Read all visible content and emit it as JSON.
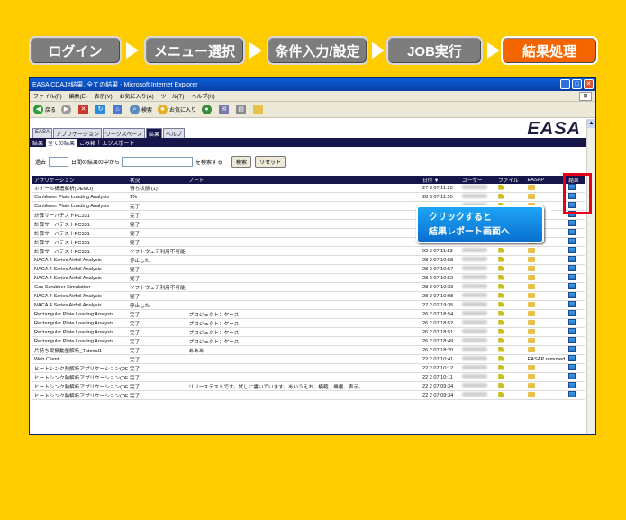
{
  "steps": [
    {
      "label": "ログイン",
      "active": false
    },
    {
      "label": "メニュー選択",
      "active": false
    },
    {
      "label": "条件入力/設定",
      "active": false
    },
    {
      "label": "JOB実行",
      "active": false
    },
    {
      "label": "結果処理",
      "active": true
    }
  ],
  "colors": {
    "background": "#FFCC00",
    "active_step": "#F46500",
    "step": "#7D7D7D",
    "highlight": "#E8001A",
    "callout": "#1CA5F5"
  },
  "browser": {
    "title": "EASA CDAJ#結果, 全ての結果 - Microsoft Internet Explorer",
    "menu": [
      "ファイル(F)",
      "編集(E)",
      "表示(V)",
      "お気に入り(A)",
      "ツール(T)",
      "ヘルプ(H)"
    ],
    "toolbar": {
      "back": "戻る",
      "search": "検索",
      "favorites": "お気に入り"
    }
  },
  "app": {
    "logo": "EASA",
    "tabs": [
      "EASA",
      "アプリケーション",
      "ワークスペース",
      "結果",
      "ヘルプ"
    ],
    "active_tab": "結果",
    "nav": [
      "結果",
      "全ての結果",
      "ごみ箱",
      "エクスポート"
    ],
    "nav_selected": "全ての結果",
    "search": {
      "prefix": "過去",
      "mid": "日間の結果の中から",
      "suffix": "を検索する",
      "search_button": "検索",
      "reset_button": "リセット"
    },
    "columns": [
      "アプリケーション",
      "状況",
      "ノート",
      "日付",
      "ユーザー",
      "ファイル",
      "EASAP",
      "結果"
    ],
    "rows": [
      {
        "app": "ホイール構造解析(DEMO)",
        "status": "待ち状態 (1)",
        "note": "",
        "date": "27 3 07 11:25",
        "easap": "folder"
      },
      {
        "app": "Cantilever Plate Loading Analysis",
        "status": "1%",
        "note": "",
        "date": "28 3 07 11:55",
        "easap": "folder"
      },
      {
        "app": "Cantilever Plate Loading Analysis",
        "status": "完了",
        "note": "",
        "date": "",
        "easap": "folder"
      },
      {
        "app": "計算サーバテストPC331",
        "status": "完了",
        "note": "",
        "date": "",
        "easap": "folder"
      },
      {
        "app": "計算サーバテストPC331",
        "status": "完了",
        "note": "",
        "date": "",
        "easap": "folder"
      },
      {
        "app": "計算サーバテストPC331",
        "status": "完了",
        "note": "",
        "date": "",
        "easap": "folder"
      },
      {
        "app": "計算サーバテストPC331",
        "status": "完了",
        "note": "",
        "date": "02 3 07 11:57",
        "easap": "folder"
      },
      {
        "app": "計算サーバテストPC331",
        "status": "ソフトウェア利用不可能",
        "note": "",
        "date": "02 3 07 11:53",
        "easap": "folder"
      },
      {
        "app": "NACA 4 Series Airfoil Analysis",
        "status": "停止した",
        "note": "",
        "date": "28 2 07 10:58",
        "easap": "folder"
      },
      {
        "app": "NACA 4 Series Airfoil Analysis",
        "status": "完了",
        "note": "",
        "date": "28 2 07 10:57",
        "easap": "folder"
      },
      {
        "app": "NACA 4 Series Airfoil Analysis",
        "status": "完了",
        "note": "",
        "date": "28 2 07 10:52",
        "easap": "folder"
      },
      {
        "app": "Gas Scrubber Simulation",
        "status": "ソフトウェア利用不可能",
        "note": "",
        "date": "28 2 07 10:23",
        "easap": "folder"
      },
      {
        "app": "NACA 4 Series Airfoil Analysis",
        "status": "完了",
        "note": "",
        "date": "28 2 07 10:08",
        "easap": "folder"
      },
      {
        "app": "NACA 4 Series Airfoil Analysis",
        "status": "停止した",
        "note": "",
        "date": "27 2 07 19:35",
        "easap": "folder"
      },
      {
        "app": "Rectangular Plate Loading Analysis",
        "status": "完了",
        "note": "プロジェクト：ケース",
        "date": "26 2 07 18:54",
        "easap": "folder"
      },
      {
        "app": "Rectangular Plate Loading Analysis",
        "status": "完了",
        "note": "プロジェクト：ケース",
        "date": "26 2 07 18:52",
        "easap": "folder"
      },
      {
        "app": "Rectangular Plate Loading Analysis",
        "status": "完了",
        "note": "プロジェクト：ケース",
        "date": "26 2 07 18:51",
        "easap": "folder"
      },
      {
        "app": "Rectangular Plate Loading Analysis",
        "status": "完了",
        "note": "プロジェクト：ケース",
        "date": "26 2 07 18:49",
        "easap": "folder"
      },
      {
        "app": "片持ち梁振動量解析_Tutorial1",
        "status": "完了",
        "note": "あああ",
        "date": "26 2 07 18:20",
        "easap": "folder"
      },
      {
        "app": "Web Client",
        "status": "完了",
        "note": "",
        "date": "22 2 07 10:41",
        "easap": "EASAP removed"
      },
      {
        "app": "ヒートシンク熱解析アプリケーション(DEMO)",
        "status": "完了",
        "note": "",
        "date": "22 2 07 10:12",
        "easap": "folder"
      },
      {
        "app": "ヒートシンク熱解析アプリケーション(DEMO)",
        "status": "完了",
        "note": "",
        "date": "22 2 07 10:11",
        "easap": "folder"
      },
      {
        "app": "ヒートシンク熱解析アプリケーション(DEMO)",
        "status": "完了",
        "note": "リリーステストです。試しに書いています。あいうえお、模範、乗権、表示。",
        "date": "22 2 07 09:34",
        "easap": "folder"
      },
      {
        "app": "ヒートシンク熱解析アプリケーション(DEMO)",
        "status": "完了",
        "note": "",
        "date": "22 2 07 09:34",
        "easap": "folder"
      }
    ]
  },
  "callout": {
    "line1": "クリックすると",
    "line2": "結果レポート画面へ"
  }
}
